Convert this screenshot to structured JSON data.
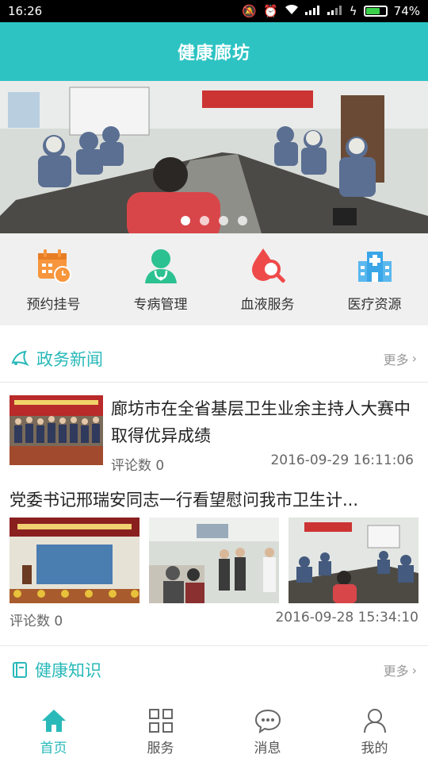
{
  "status_bar": {
    "time": "16:26",
    "battery": "74%",
    "battery_level": 0.74
  },
  "header": {
    "title": "健康廊坊"
  },
  "banner": {
    "slide_count": 4,
    "active_index": 0
  },
  "quick_menu": [
    {
      "label": "预约挂号",
      "icon": "calendar-clock-icon",
      "color": "#f7963d"
    },
    {
      "label": "专病管理",
      "icon": "doctor-icon",
      "color": "#2cc190"
    },
    {
      "label": "血液服务",
      "icon": "blood-search-icon",
      "color": "#ef4a4a"
    },
    {
      "label": "医疗资源",
      "icon": "hospital-icon",
      "color": "#3aa6e8"
    }
  ],
  "news_section": {
    "title": "政务新闻",
    "more": "更多"
  },
  "news": [
    {
      "title": "廊坊市在全省基层卫生业余主持人大赛中取得优异成绩",
      "comments": "评论数 0",
      "time": "2016-09-29 16:11:06"
    },
    {
      "title": "党委书记邢瑞安同志一行看望慰问我市卫生计...",
      "comments": "评论数 0",
      "time": "2016-09-28 15:34:10"
    }
  ],
  "knowledge_section": {
    "title": "健康知识",
    "more": "更多"
  },
  "tabs": [
    {
      "label": "首页",
      "icon": "home-icon"
    },
    {
      "label": "服务",
      "icon": "grid-icon"
    },
    {
      "label": "消息",
      "icon": "message-icon"
    },
    {
      "label": "我的",
      "icon": "user-icon"
    }
  ],
  "colors": {
    "accent": "#2dc3c3",
    "accent_text": "#29b9b9"
  }
}
